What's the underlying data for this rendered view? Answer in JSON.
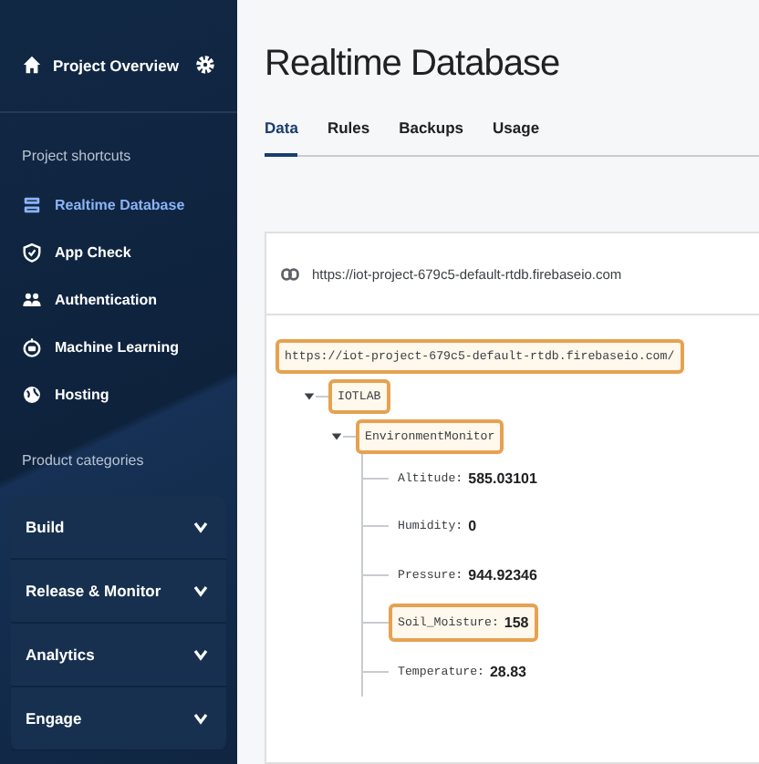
{
  "sidebar": {
    "header": {
      "title": "Project Overview"
    },
    "shortcuts_heading": "Project shortcuts",
    "shortcuts": [
      {
        "label": "Realtime Database",
        "selected": true
      },
      {
        "label": "App Check",
        "selected": false
      },
      {
        "label": "Authentication",
        "selected": false
      },
      {
        "label": "Machine Learning",
        "selected": false
      },
      {
        "label": "Hosting",
        "selected": false
      }
    ],
    "categories_heading": "Product categories",
    "categories": [
      {
        "label": "Build",
        "expanded": false
      },
      {
        "label": "Release & Monitor",
        "expanded": false
      },
      {
        "label": "Analytics",
        "expanded": false
      },
      {
        "label": "Engage",
        "expanded": false
      }
    ]
  },
  "page": {
    "title": "Realtime Database",
    "tabs": [
      {
        "label": "Data",
        "selected": true
      },
      {
        "label": "Rules",
        "selected": false
      },
      {
        "label": "Backups",
        "selected": false
      },
      {
        "label": "Usage",
        "selected": false
      }
    ],
    "database_url": "https://iot-project-679c5-default-rtdb.firebaseio.com",
    "tree": {
      "label": "https://iot-project-679c5-default-rtdb.firebaseio.com/",
      "highlighted": true,
      "children": [
        {
          "label": "IOTLAB",
          "expanded": true,
          "highlighted": true,
          "children": [
            {
              "label": "EnvironmentMonitor",
              "expanded": true,
              "highlighted": true,
              "children": [
                {
                  "label": "Altitude:",
                  "value": "585.03101",
                  "highlighted": false
                },
                {
                  "label": "Humidity:",
                  "value": "0",
                  "highlighted": false
                },
                {
                  "label": "Pressure:",
                  "value": "944.92346",
                  "highlighted": false
                },
                {
                  "label": "Soil_Moisture:",
                  "value": "158",
                  "highlighted": true
                },
                {
                  "label": "Temperature:",
                  "value": "28.83",
                  "highlighted": false
                }
              ]
            }
          ]
        }
      ]
    }
  }
}
